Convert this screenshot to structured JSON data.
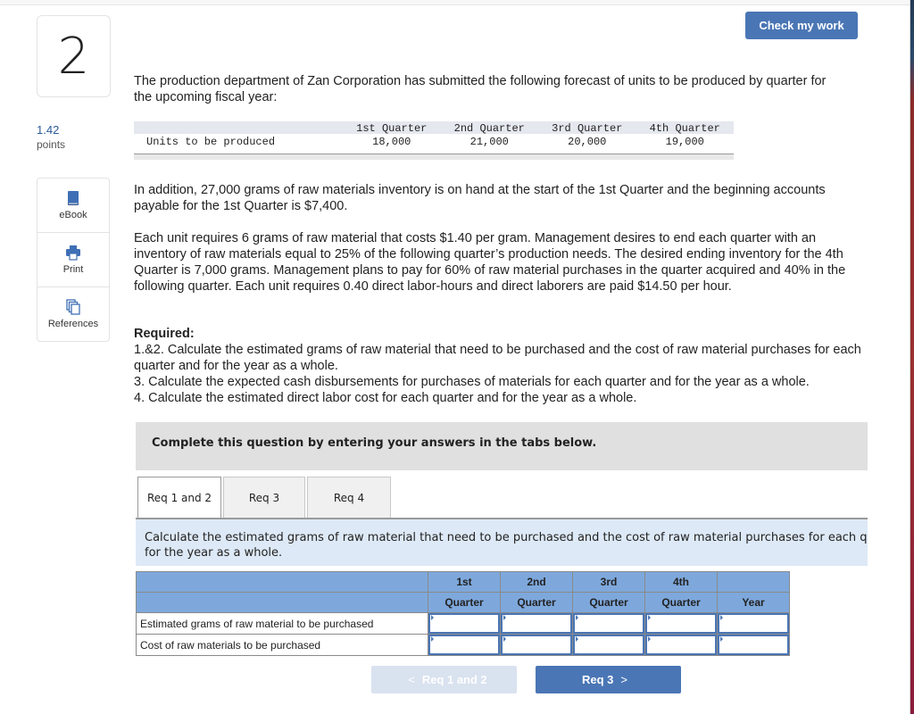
{
  "question": {
    "number": "2",
    "points_value": "1.42",
    "points_label": "points"
  },
  "tools": [
    {
      "label": "eBook",
      "icon": "book-icon"
    },
    {
      "label": "Print",
      "icon": "printer-icon"
    },
    {
      "label": "References",
      "icon": "documents-icon"
    }
  ],
  "header": {
    "check_button": "Check my work"
  },
  "intro": "The production department of Zan Corporation has submitted the following forecast of units to be produced by quarter for the upcoming fiscal year:",
  "units_table": {
    "headers": [
      "1st Quarter",
      "2nd Quarter",
      "3rd Quarter",
      "4th Quarter"
    ],
    "row_label": "Units to be produced",
    "values": [
      "18,000",
      "21,000",
      "20,000",
      "19,000"
    ]
  },
  "paragraphs": {
    "inventory": "In addition, 27,000 grams of raw materials inventory is on hand at the start of the 1st Quarter and the beginning accounts payable for the 1st Quarter is $7,400.",
    "details": "Each unit requires 6 grams of raw material that costs $1.40 per gram. Management desires to end each quarter with an inventory of raw materials equal to 25% of the following quarter’s production needs. The desired ending inventory for the 4th Quarter is 7,000 grams. Management plans to pay for 60% of raw material purchases in the quarter acquired and 40% in the following quarter. Each unit requires 0.40 direct labor-hours and direct laborers are paid $14.50 per hour."
  },
  "required": {
    "title": "Required:",
    "items": [
      "1.&2. Calculate the estimated grams of raw material that need to be purchased and the cost of raw material purchases for each quarter and for the year as a whole.",
      "3. Calculate the expected cash disbursements for purchases of materials for each quarter and for the year as a whole.",
      "4. Calculate the estimated direct labor cost for each quarter and for the year as a whole."
    ]
  },
  "instruction": "Complete this question by entering your answers in the tabs below.",
  "tabs": [
    {
      "label": "Req 1 and 2",
      "active": true
    },
    {
      "label": "Req 3",
      "active": false
    },
    {
      "label": "Req 4",
      "active": false
    }
  ],
  "tab_description": "Calculate the estimated grams of raw material that need to be purchased and the cost of raw material purchases for each quarter and for the year as a whole.",
  "answer_table": {
    "header_row1": [
      "",
      "1st",
      "2nd",
      "3rd",
      "4th",
      ""
    ],
    "header_row2": [
      "",
      "Quarter",
      "Quarter",
      "Quarter",
      "Quarter",
      "Year"
    ],
    "rows": [
      {
        "label": "Estimated grams of raw material to be purchased",
        "values": [
          "",
          "",
          "",
          "",
          ""
        ]
      },
      {
        "label": "Cost of raw materials to be purchased",
        "values": [
          "",
          "",
          "",
          "",
          ""
        ]
      }
    ]
  },
  "nav": {
    "prev_label": "Req 1 and 2",
    "next_label": "Req 3",
    "prev_chevron": "<",
    "next_chevron": ">"
  }
}
